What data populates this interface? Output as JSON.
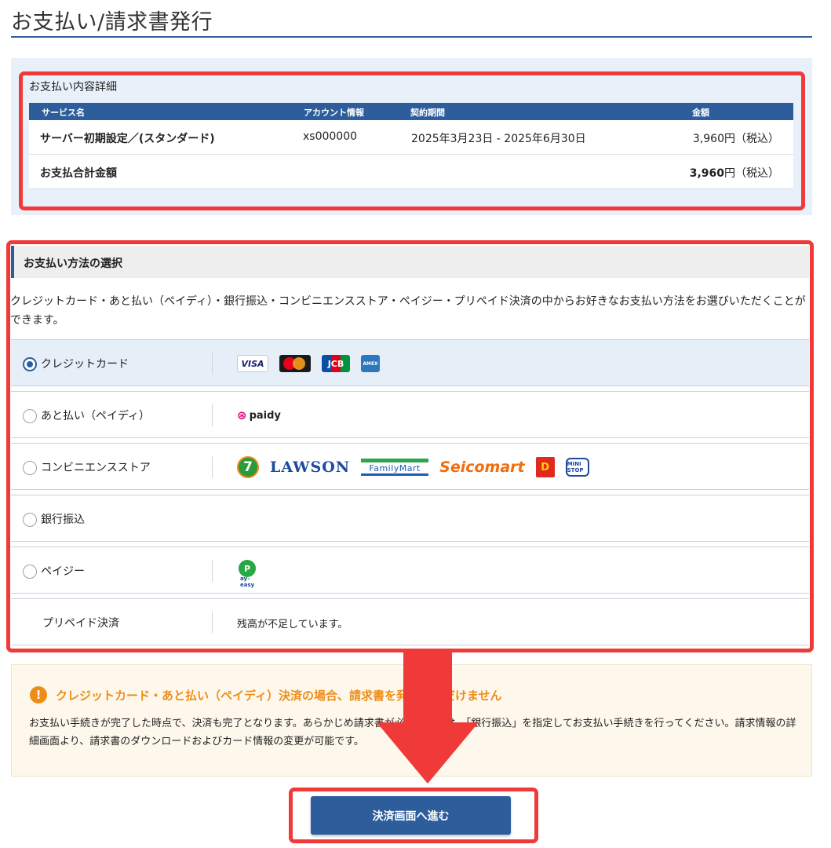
{
  "page": {
    "title": "お支払い/請求書発行"
  },
  "summary": {
    "heading": "お支払い内容詳細",
    "columns": {
      "service": "サービス名",
      "account": "アカウント情報",
      "period": "契約期間",
      "amount": "金額"
    },
    "row": {
      "service": "サーバー初期設定／(スタンダード)",
      "account": "xs000000",
      "period": "2025年3月23日 - 2025年6月30日",
      "amount": "3,960円（税込）"
    },
    "total": {
      "label": "お支払合計金額",
      "amount": "3,960",
      "unit": "円（税込）"
    }
  },
  "payment": {
    "heading": "お支払い方法の選択",
    "description": "クレジットカード・あと払い（ペイディ）・銀行振込・コンビニエンスストア・ペイジー・プリペイド決済の中からお好きなお支払い方法をお選びいただくことができます。",
    "options": [
      {
        "label": "クレジットカード",
        "selected": true,
        "logos": [
          "visa-logo",
          "mastercard-logo",
          "jcb-logo",
          "amex-logo"
        ]
      },
      {
        "label": "あと払い（ペイディ）",
        "selected": false,
        "logos": [
          "paidy-logo"
        ]
      },
      {
        "label": "コンビニエンスストア",
        "selected": false,
        "logos": [
          "seven-eleven-logo",
          "lawson-logo",
          "familymart-logo",
          "seicomart-logo",
          "daily-yamazaki-logo",
          "ministop-logo"
        ]
      },
      {
        "label": "銀行振込",
        "selected": false,
        "logos": []
      },
      {
        "label": "ペイジー",
        "selected": false,
        "logos": [
          "payeasy-logo"
        ]
      },
      {
        "label": "プリペイド決済",
        "selected": false,
        "message": "残高が不足しています。"
      }
    ],
    "logo_text": {
      "visa": "VISA",
      "jcb": "JCB",
      "amex": "AMEX",
      "paidy": "paidy",
      "seven": "7",
      "lawson": "LAWSON",
      "familymart": "FamilyMart",
      "seicomart": "Seicomart",
      "daily": "D",
      "ministop": "MINI STOP",
      "payeasy_p": "P",
      "payeasy_sub": "ay-easy"
    }
  },
  "notice": {
    "title": "クレジットカード・あと払い（ペイディ）決済の場合、請求書を発行いただけません",
    "body": "お支払い手続きが完了した時点で、決済も完了となります。あらかじめ請求書が必要な場合は、「銀行振込」を指定してお支払い手続きを行ってください。請求情報の詳細画面より、請求書のダウンロードおよびカード情報の変更が可能です。"
  },
  "actions": {
    "proceed_label": "決済画面へ進む"
  },
  "colors": {
    "accent": "#2d5e9b",
    "highlight": "#f03a3a",
    "warning": "#f08c16"
  }
}
